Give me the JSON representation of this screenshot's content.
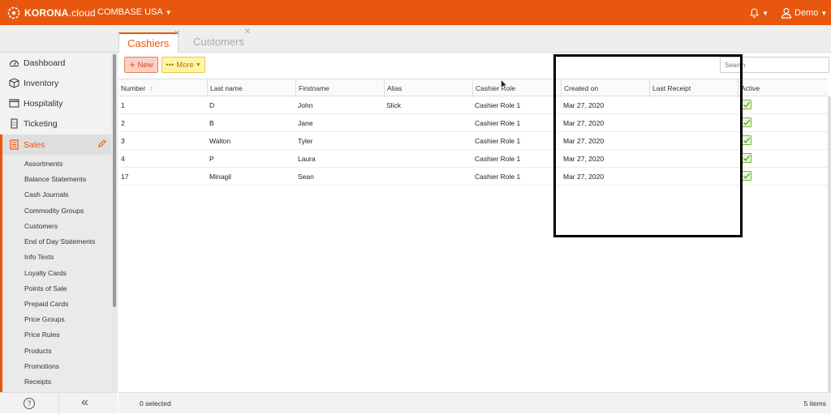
{
  "header": {
    "brand": "KORONA",
    "brand_suffix": ".cloud",
    "company": "COMBASE USA",
    "user": "Demo"
  },
  "tabs": [
    {
      "label": "Cashiers",
      "active": true
    },
    {
      "label": "Customers",
      "active": false
    }
  ],
  "sidebar": {
    "items": [
      {
        "label": "Dashboard",
        "icon": "dashboard-icon"
      },
      {
        "label": "Inventory",
        "icon": "box-icon"
      },
      {
        "label": "Hospitality",
        "icon": "hospitality-icon"
      },
      {
        "label": "Ticketing",
        "icon": "ticket-icon"
      },
      {
        "label": "Sales",
        "icon": "sales-icon"
      }
    ],
    "subitems": [
      "Assortments",
      "Balance Statements",
      "Cash Journals",
      "Commodity Groups",
      "Customers",
      "End of Day Statements",
      "Info Texts",
      "Loyalty Cards",
      "Points of Sale",
      "Prepaid Cards",
      "Price Groups",
      "Price Rules",
      "Products",
      "Promotions",
      "Receipts"
    ],
    "help": "?",
    "collapse": "«"
  },
  "toolbar": {
    "new_label": "New",
    "more_label": "More",
    "search_placeholder": "Search"
  },
  "grid": {
    "columns": [
      "Number",
      "Last name",
      "Firstname",
      "Alias",
      "Cashier Role",
      "Created on",
      "Last Receipt",
      "Active"
    ],
    "rows": [
      {
        "number": "1",
        "last_name": "D",
        "firstname": "John",
        "alias": "Slick",
        "role": "Cashier Role 1",
        "created": "Mar 27, 2020",
        "last_receipt": "",
        "active": true
      },
      {
        "number": "2",
        "last_name": "B",
        "firstname": "Jane",
        "alias": "",
        "role": "Cashier Role 1",
        "created": "Mar 27, 2020",
        "last_receipt": "",
        "active": true
      },
      {
        "number": "3",
        "last_name": "Walton",
        "firstname": "Tyler",
        "alias": "",
        "role": "Cashier Role 1",
        "created": "Mar 27, 2020",
        "last_receipt": "",
        "active": true
      },
      {
        "number": "4",
        "last_name": "P",
        "firstname": "Laura",
        "alias": "",
        "role": "Cashier Role 1",
        "created": "Mar 27, 2020",
        "last_receipt": "",
        "active": true
      },
      {
        "number": "17",
        "last_name": "Minagil",
        "firstname": "Sean",
        "alias": "",
        "role": "Cashier Role 1",
        "created": "Mar 27, 2020",
        "last_receipt": "",
        "active": true
      }
    ]
  },
  "status": {
    "selected": "0 selected",
    "count": "5 items"
  },
  "colors": {
    "accent": "#e8570e",
    "highlight_border": "#000000"
  }
}
